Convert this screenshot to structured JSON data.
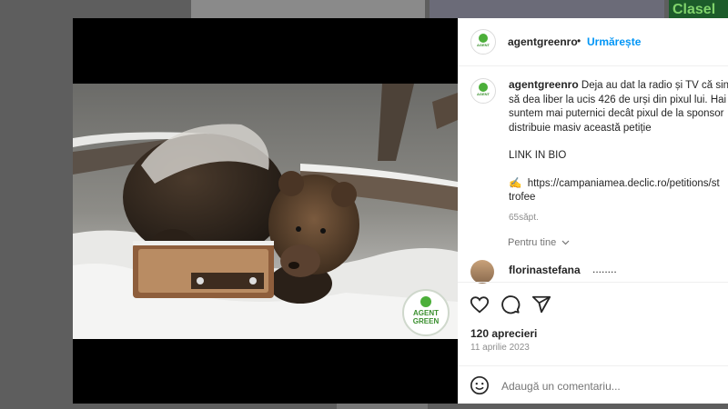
{
  "background": {
    "top_banner_text": "Clasel"
  },
  "post": {
    "username": "agentgreenro",
    "separator": "•",
    "follow_label": "Urmărește",
    "logo_text_top": "AGENT",
    "logo_text_bottom": "GREEN",
    "caption_lines": [
      "Deja au dat la radio și TV că sini",
      "să dea liber la ucis 426 de urși din pixul lui. Hai",
      "suntem mai puternici decât pixul de la sponsor",
      "distribuie masiv această petiție"
    ],
    "caption_link_label": "LINK IN BIO",
    "caption_emoji": "✍️",
    "caption_url": "https://campaniamea.declic.ro/petitions/st",
    "caption_url_cont": "trofee",
    "caption_time": "65săpt.",
    "translation_label": "Pentru tine",
    "comment": {
      "username": "florinastefana",
      "text": "........"
    },
    "likes": "120 aprecieri",
    "date": "11 aprilie 2023",
    "comment_placeholder": "Adaugă un comentariu..."
  },
  "icons": {
    "like": "heart-icon",
    "comment": "comment-icon",
    "share": "share-icon",
    "emoji": "emoji-icon",
    "chevron": "chevron-down-icon"
  },
  "colors": {
    "follow": "#0095f6",
    "brand_green": "#3a8f2e"
  }
}
